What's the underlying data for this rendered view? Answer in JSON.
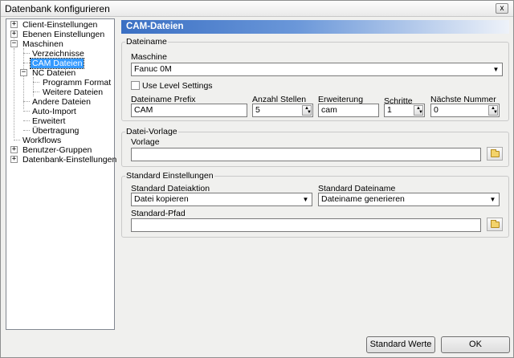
{
  "window": {
    "title": "Datenbank konfigurieren",
    "close_glyph": "x"
  },
  "tree": {
    "items": [
      {
        "label": "Client-Einstellungen",
        "expander": "+"
      },
      {
        "label": "Ebenen Einstellungen",
        "expander": "+"
      },
      {
        "label": "Maschinen",
        "expander": "−"
      },
      {
        "label": "Verzeichnisse"
      },
      {
        "label": "CAM Dateien",
        "selected": true
      },
      {
        "label": "NC Dateien",
        "expander": "−"
      },
      {
        "label": "Programm Format"
      },
      {
        "label": "Weitere Dateien"
      },
      {
        "label": "Andere Dateien"
      },
      {
        "label": "Auto-Import"
      },
      {
        "label": "Erweitert"
      },
      {
        "label": "Übertragung"
      },
      {
        "label": "Workflows"
      },
      {
        "label": "Benutzer-Gruppen",
        "expander": "+"
      },
      {
        "label": "Datenbank-Einstellungen",
        "expander": "+"
      }
    ]
  },
  "panel": {
    "title": "CAM-Dateien",
    "dateiname_group": {
      "title": "Dateiname",
      "maschine_label": "Maschine",
      "maschine_value": "Fanuc 0M",
      "use_level_label": "Use Level Settings",
      "use_level_checked": false,
      "prefix_label": "Dateiname Prefix",
      "prefix_value": "CAM",
      "anzahl_label": "Anzahl Stellen",
      "anzahl_value": "5",
      "erweiterung_label": "Erweiterung",
      "erweiterung_value": "cam",
      "schritte_label": "Schritte",
      "schritte_value": "1",
      "naechste_label": "Nächste Nummer",
      "naechste_value": "0"
    },
    "vorlage_group": {
      "title": "Datei-Vorlage",
      "vorlage_label": "Vorlage",
      "vorlage_value": ""
    },
    "standard_group": {
      "title": "Standard Einstellungen",
      "aktion_label": "Standard Dateiaktion",
      "aktion_value": "Datei kopieren",
      "dateiname_label": "Standard Dateiname",
      "dateiname_value": "Dateiname generieren",
      "pfad_label": "Standard-Pfad",
      "pfad_value": ""
    }
  },
  "buttons": {
    "standard_werte": "Standard Werte",
    "ok": "OK"
  },
  "icons": {
    "combo_arrow": "▼",
    "spin_up": "▲",
    "spin_down": "▼"
  }
}
